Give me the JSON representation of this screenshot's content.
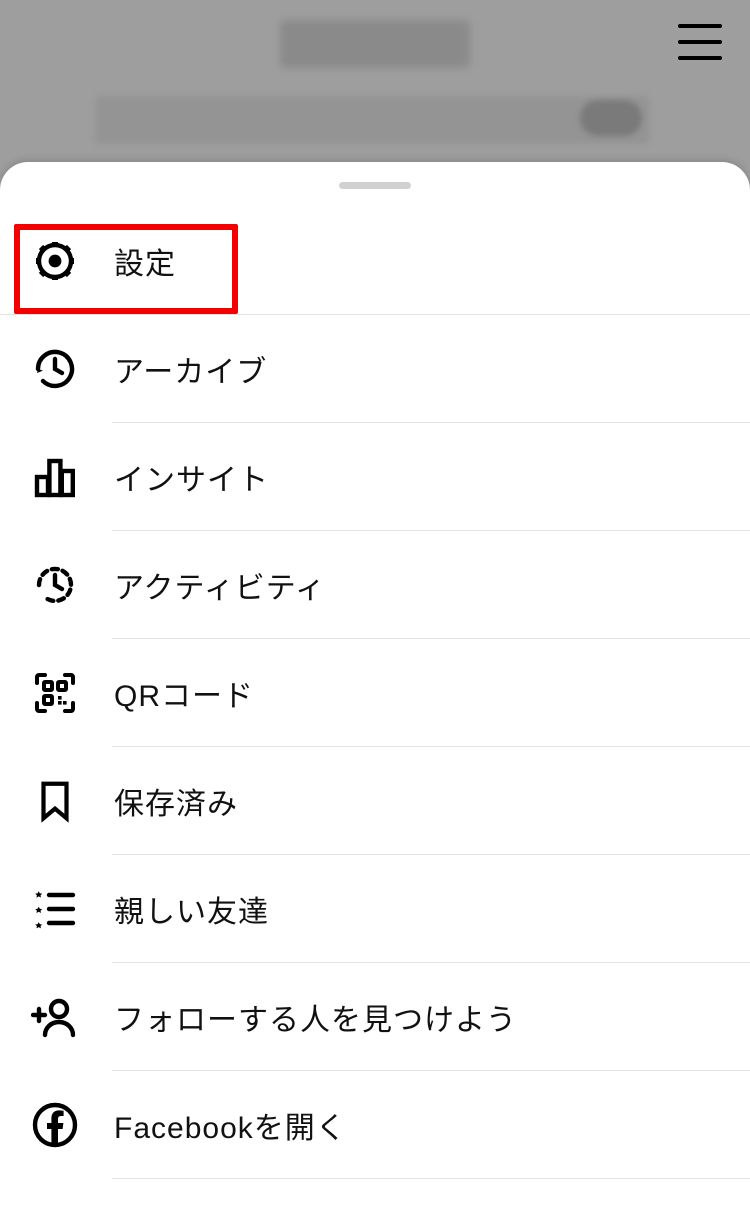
{
  "menu": {
    "items": [
      {
        "label": "設定"
      },
      {
        "label": "アーカイブ"
      },
      {
        "label": "インサイト"
      },
      {
        "label": "アクティビティ"
      },
      {
        "label": "QRコード"
      },
      {
        "label": "保存済み"
      },
      {
        "label": "親しい友達"
      },
      {
        "label": "フォローする人を見つけよう"
      },
      {
        "label": "Facebookを開く"
      }
    ]
  }
}
